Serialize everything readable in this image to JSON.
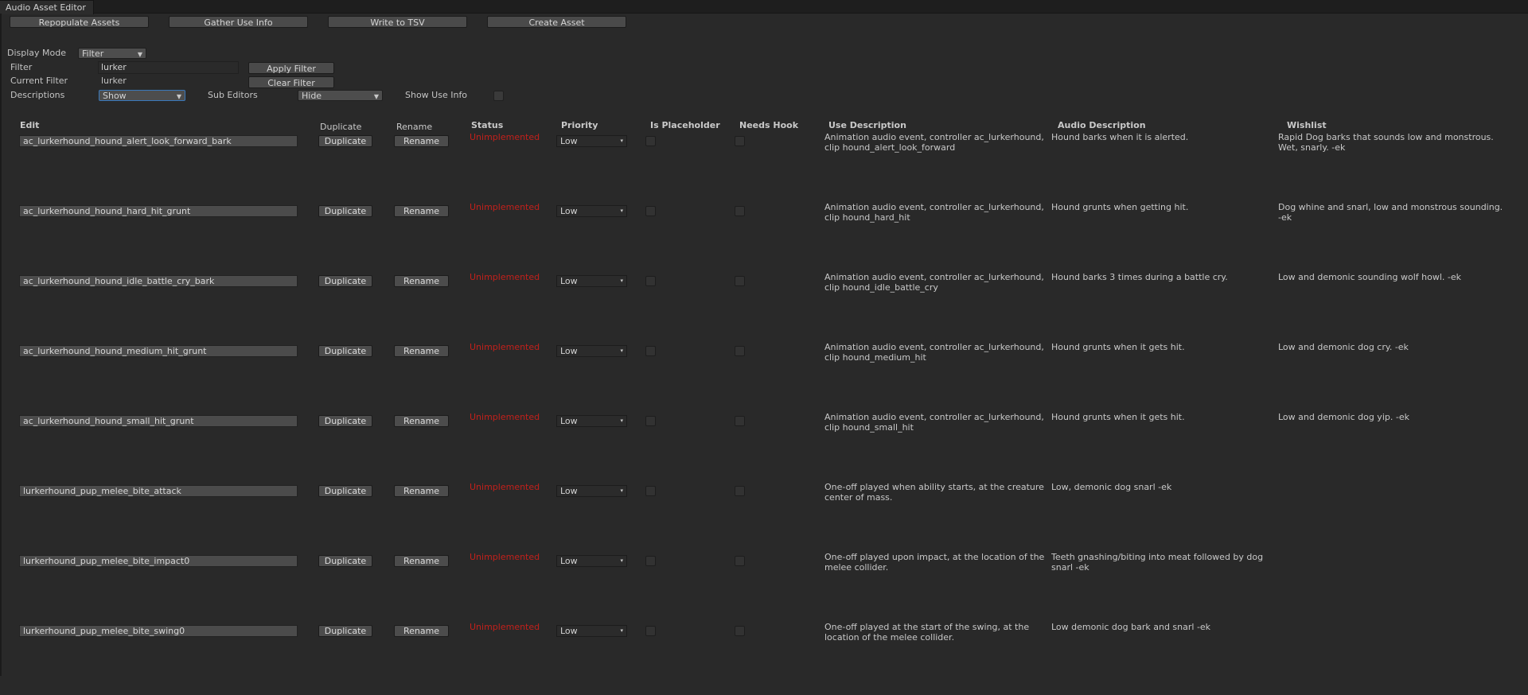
{
  "window": {
    "title": "Audio Asset Editor"
  },
  "toolbar": {
    "repopulate": "Repopulate Assets",
    "gather": "Gather Use Info",
    "write_tsv": "Write to TSV",
    "create": "Create Asset"
  },
  "controls": {
    "display_mode_label": "Display Mode",
    "display_mode_value": "Filter",
    "filter_label": "Filter",
    "filter_value": "lurker",
    "apply_filter": "Apply Filter",
    "current_filter_label": "Current Filter",
    "current_filter_value": "lurker",
    "clear_filter": "Clear Filter",
    "descriptions_label": "Descriptions",
    "descriptions_value": "Show",
    "sub_editors_label": "Sub Editors",
    "sub_editors_value": "Hide",
    "show_use_info_label": "Show Use Info"
  },
  "table": {
    "headers": {
      "edit": "Edit",
      "duplicate": "Duplicate",
      "rename": "Rename",
      "status": "Status",
      "priority": "Priority",
      "is_placeholder": "Is Placeholder",
      "needs_hook": "Needs Hook",
      "use_description": "Use Description",
      "audio_description": "Audio Description",
      "wishlist": "Wishlist"
    },
    "rows": [
      {
        "name": "ac_lurkerhound_hound_alert_look_forward_bark",
        "duplicate": "Duplicate",
        "rename": "Rename",
        "status": "Unimplemented",
        "priority": "Low",
        "use_line1": "Animation audio event, controller ac_lurkerhound,",
        "use_line2": "clip hound_alert_look_forward",
        "audio_line1": "Hound barks when it is alerted.",
        "audio_line2": "",
        "wish_line1": "Rapid Dog barks that sounds low and monstrous.",
        "wish_line2": "Wet, snarly. -ek"
      },
      {
        "name": "ac_lurkerhound_hound_hard_hit_grunt",
        "duplicate": "Duplicate",
        "rename": "Rename",
        "status": "Unimplemented",
        "priority": "Low",
        "use_line1": "Animation audio event, controller ac_lurkerhound,",
        "use_line2": "clip hound_hard_hit",
        "audio_line1": "Hound grunts when getting hit.",
        "audio_line2": "",
        "wish_line1": "Dog whine and snarl, low and monstrous sounding.",
        "wish_line2": "-ek"
      },
      {
        "name": "ac_lurkerhound_hound_idle_battle_cry_bark",
        "duplicate": "Duplicate",
        "rename": "Rename",
        "status": "Unimplemented",
        "priority": "Low",
        "use_line1": "Animation audio event, controller ac_lurkerhound,",
        "use_line2": "clip hound_idle_battle_cry",
        "audio_line1": "Hound barks 3 times during a battle cry.",
        "audio_line2": "",
        "wish_line1": "Low and demonic sounding wolf howl. -ek",
        "wish_line2": ""
      },
      {
        "name": "ac_lurkerhound_hound_medium_hit_grunt",
        "duplicate": "Duplicate",
        "rename": "Rename",
        "status": "Unimplemented",
        "priority": "Low",
        "use_line1": "Animation audio event, controller ac_lurkerhound,",
        "use_line2": "clip hound_medium_hit",
        "audio_line1": "Hound grunts when it gets hit.",
        "audio_line2": "",
        "wish_line1": "Low and demonic dog cry. -ek",
        "wish_line2": ""
      },
      {
        "name": "ac_lurkerhound_hound_small_hit_grunt",
        "duplicate": "Duplicate",
        "rename": "Rename",
        "status": "Unimplemented",
        "priority": "Low",
        "use_line1": "Animation audio event, controller ac_lurkerhound,",
        "use_line2": "clip hound_small_hit",
        "audio_line1": "Hound grunts when it gets hit.",
        "audio_line2": "",
        "wish_line1": "Low and demonic dog yip. -ek",
        "wish_line2": ""
      },
      {
        "name": "lurkerhound_pup_melee_bite_attack",
        "duplicate": "Duplicate",
        "rename": "Rename",
        "status": "Unimplemented",
        "priority": "Low",
        "use_line1": "One-off played when ability starts, at the creature",
        "use_line2": "center of mass.",
        "audio_line1": "Low, demonic dog snarl -ek",
        "audio_line2": "",
        "wish_line1": "",
        "wish_line2": ""
      },
      {
        "name": "lurkerhound_pup_melee_bite_impact0",
        "duplicate": "Duplicate",
        "rename": "Rename",
        "status": "Unimplemented",
        "priority": "Low",
        "use_line1": "One-off played upon impact, at the location of the",
        "use_line2": "melee collider.",
        "audio_line1": "Teeth gnashing/biting into meat followed by dog",
        "audio_line2": "snarl -ek",
        "wish_line1": "",
        "wish_line2": ""
      },
      {
        "name": "lurkerhound_pup_melee_bite_swing0",
        "duplicate": "Duplicate",
        "rename": "Rename",
        "status": "Unimplemented",
        "priority": "Low",
        "use_line1": "One-off played at the start of the swing, at the",
        "use_line2": "location of the melee collider.",
        "audio_line1": "Low demonic dog bark and snarl -ek",
        "audio_line2": "",
        "wish_line1": "",
        "wish_line2": ""
      }
    ]
  }
}
